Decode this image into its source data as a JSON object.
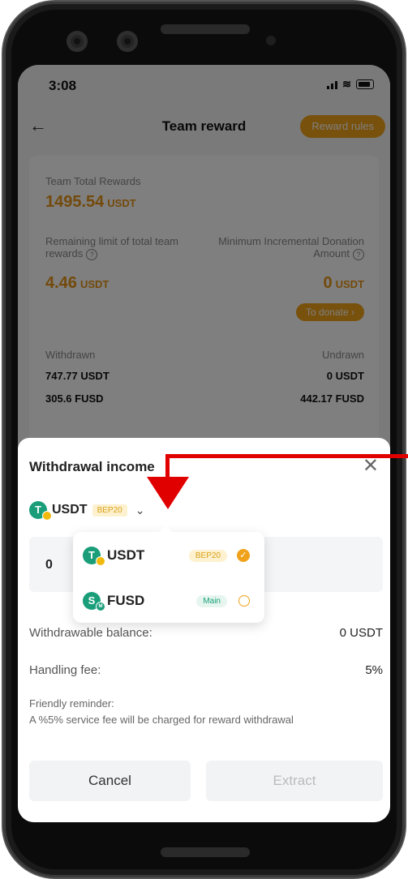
{
  "status": {
    "time": "3:08"
  },
  "header": {
    "title": "Team reward",
    "rules_label": "Reward rules",
    "back_icon": "arrow-left-icon"
  },
  "card": {
    "total_label": "Team Total Rewards",
    "total_value": "1495.54",
    "total_unit": "USDT",
    "remaining_label": "Remaining limit of total team rewards",
    "remaining_value": "4.46",
    "remaining_unit": "USDT",
    "min_label": "Minimum Incremental Donation Amount",
    "min_value": "0",
    "min_unit": "USDT",
    "donate_label": "To donate",
    "withdrawn_label": "Withdrawn",
    "undrawn_label": "Undrawn",
    "withdrawn_usdt": "747.77 USDT",
    "withdrawn_fusd": "305.6 FUSD",
    "undrawn_usdt": "0 USDT",
    "undrawn_fusd": "442.17 FUSD"
  },
  "sheet": {
    "title": "Withdrawal income",
    "token": "USDT",
    "token_badge": "BEP20",
    "amount": "0",
    "balance_label": "Withdrawable balance:",
    "balance_value": "0 USDT",
    "fee_label": "Handling fee:",
    "fee_value": "5%",
    "reminder_title": "Friendly reminder:",
    "reminder_text": "A %5% service fee will be charged for reward withdrawal",
    "cancel_label": "Cancel",
    "extract_label": "Extract"
  },
  "dropdown": {
    "items": [
      {
        "token": "USDT",
        "badge": "BEP20",
        "selected": true
      },
      {
        "token": "FUSD",
        "badge": "Main",
        "selected": false
      }
    ]
  },
  "colors": {
    "accent": "#f0a21a",
    "green": "#1a9e7a",
    "annotation": "#e10000"
  }
}
